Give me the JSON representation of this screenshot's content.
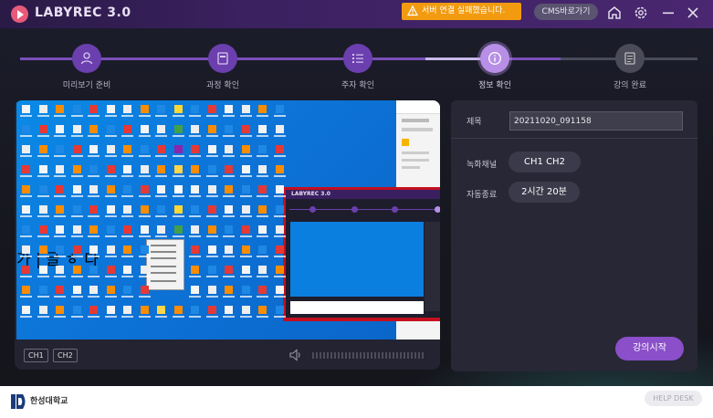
{
  "app": {
    "title": "LABYREC 3.0"
  },
  "titlebar": {
    "warning": "서버 연결 실패했습니다.",
    "cms_button": "CMS바로가기",
    "icons": [
      "home-icon",
      "gear-icon",
      "minimize-icon",
      "close-icon"
    ]
  },
  "colors": {
    "accent": "#8a4fc9",
    "warning": "#f29b11",
    "titlebar": "#3b2160"
  },
  "steps": [
    {
      "label": "미리보기 준비",
      "icon": "user-icon",
      "state": "done"
    },
    {
      "label": "과정 확인",
      "icon": "book-icon",
      "state": "done"
    },
    {
      "label": "주자 확인",
      "icon": "list-icon",
      "state": "done"
    },
    {
      "label": "정보 확인",
      "icon": "info-icon",
      "state": "active"
    },
    {
      "label": "강의 완료",
      "icon": "document-icon",
      "state": "pending"
    }
  ],
  "preview": {
    "channels": [
      "CH1",
      "CH2"
    ],
    "overlay_text": "가 | 글 ㅎ 다",
    "nested_title": "LABYREC 3.0"
  },
  "info": {
    "title_label": "제목",
    "title_value": "20211020_091158",
    "channel_label": "녹화채널",
    "channel_value": "CH1  CH2",
    "auto_end_label": "자동종료",
    "auto_end_value": "2시간 20분",
    "start_button": "강의시작"
  },
  "footer": {
    "org_name": "한성대학교",
    "help_button": "HELP DESK"
  }
}
